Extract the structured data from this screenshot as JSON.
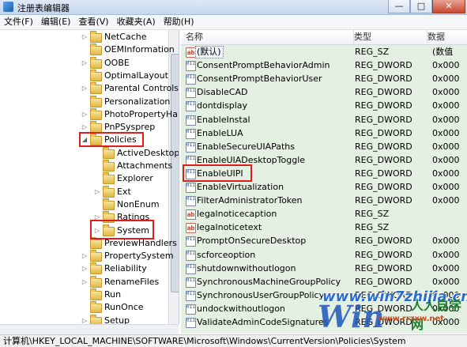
{
  "window": {
    "title": "注册表编辑器",
    "minimize": "—",
    "maximize": "□",
    "close": "✕"
  },
  "menu": [
    "文件(F)",
    "编辑(E)",
    "查看(V)",
    "收藏夹(A)",
    "帮助(H)"
  ],
  "tree": [
    {
      "label": "NetCache",
      "expander": "▷",
      "selected": false
    },
    {
      "label": "OEMInformation",
      "expander": "",
      "selected": false
    },
    {
      "label": "OOBE",
      "expander": "▷",
      "selected": false
    },
    {
      "label": "OptimalLayout",
      "expander": "",
      "selected": false
    },
    {
      "label": "Parental Controls",
      "expander": "▷",
      "selected": false
    },
    {
      "label": "Personalization",
      "expander": "",
      "selected": false
    },
    {
      "label": "PhotoPropertyHa",
      "expander": "▷",
      "selected": false
    },
    {
      "label": "PnPSysprep",
      "expander": "▷",
      "selected": false
    },
    {
      "label": "Policies",
      "expander": "◢",
      "selected": false
    },
    {
      "label": "ActiveDesktop",
      "expander": "",
      "selected": false
    },
    {
      "label": "Attachments",
      "expander": "",
      "selected": false
    },
    {
      "label": "Explorer",
      "expander": "",
      "selected": false
    },
    {
      "label": "Ext",
      "expander": "▷",
      "selected": false
    },
    {
      "label": "NonEnum",
      "expander": "",
      "selected": false
    },
    {
      "label": "Ratings",
      "expander": "▷",
      "selected": false
    },
    {
      "label": "System",
      "expander": "▷",
      "selected": true
    },
    {
      "label": "PreviewHandlers",
      "expander": "",
      "selected": false
    },
    {
      "label": "PropertySystem",
      "expander": "▷",
      "selected": false
    },
    {
      "label": "Reliability",
      "expander": "▷",
      "selected": false
    },
    {
      "label": "RenameFiles",
      "expander": "▷",
      "selected": false
    },
    {
      "label": "Run",
      "expander": "",
      "selected": false
    },
    {
      "label": "RunOnce",
      "expander": "",
      "selected": false
    },
    {
      "label": "Setup",
      "expander": "▷",
      "selected": false
    }
  ],
  "list": {
    "columns": {
      "name": "名称",
      "type": "类型",
      "data": "数据"
    },
    "rows": [
      {
        "name": "(默认)",
        "type": "REG_SZ",
        "data": "(数值",
        "kind": "sz"
      },
      {
        "name": "ConsentPromptBehaviorAdmin",
        "type": "REG_DWORD",
        "data": "0x000",
        "kind": "dw"
      },
      {
        "name": "ConsentPromptBehaviorUser",
        "type": "REG_DWORD",
        "data": "0x000",
        "kind": "dw"
      },
      {
        "name": "DisableCAD",
        "type": "REG_DWORD",
        "data": "0x000",
        "kind": "dw"
      },
      {
        "name": "dontdisplay",
        "type": "REG_DWORD",
        "data": "0x000",
        "kind": "dw"
      },
      {
        "name": "EnableInstal",
        "type": "REG_DWORD",
        "data": "0x000",
        "kind": "dw"
      },
      {
        "name": "EnableLUA",
        "type": "REG_DWORD",
        "data": "0x000",
        "kind": "dw"
      },
      {
        "name": "EnableSecureUIAPaths",
        "type": "REG_DWORD",
        "data": "0x000",
        "kind": "dw"
      },
      {
        "name": "EnableUIADesktopToggle",
        "type": "REG_DWORD",
        "data": "0x000",
        "kind": "dw"
      },
      {
        "name": "EnableUIPI",
        "type": "REG_DWORD",
        "data": "0x000",
        "kind": "dw"
      },
      {
        "name": "EnableVirtualization",
        "type": "REG_DWORD",
        "data": "0x000",
        "kind": "dw"
      },
      {
        "name": "FilterAdministratorToken",
        "type": "REG_DWORD",
        "data": "0x000",
        "kind": "dw"
      },
      {
        "name": "legalnoticecaption",
        "type": "REG_SZ",
        "data": "",
        "kind": "sz"
      },
      {
        "name": "legalnoticetext",
        "type": "REG_SZ",
        "data": "",
        "kind": "sz"
      },
      {
        "name": "PromptOnSecureDesktop",
        "type": "REG_DWORD",
        "data": "0x000",
        "kind": "dw"
      },
      {
        "name": "scforceoption",
        "type": "REG_DWORD",
        "data": "0x000",
        "kind": "dw"
      },
      {
        "name": "shutdownwithoutlogon",
        "type": "REG_DWORD",
        "data": "0x000",
        "kind": "dw"
      },
      {
        "name": "SynchronousMachineGroupPolicy",
        "type": "REG_DWORD",
        "data": "0x000",
        "kind": "dw"
      },
      {
        "name": "SynchronousUserGroupPolicy",
        "type": "REG_DWORD",
        "data": "0x000",
        "kind": "dw"
      },
      {
        "name": "undockwithoutlogon",
        "type": "REG_DWORD",
        "data": "0x000",
        "kind": "dw"
      },
      {
        "name": "ValidateAdminCodeSignatures",
        "type": "REG_DWORD",
        "data": "0x000",
        "kind": "dw"
      }
    ]
  },
  "status": "计算机\\HKEY_LOCAL_MACHINE\\SOFTWARE\\Microsoft\\Windows\\CurrentVersion\\Policies\\System",
  "watermark": {
    "site": "www.win7zhijia.cn",
    "brand": "Win",
    "logo": "人人自学网",
    "url2": "www.rrzxw.net"
  },
  "highlight_color": "#e01d1d"
}
